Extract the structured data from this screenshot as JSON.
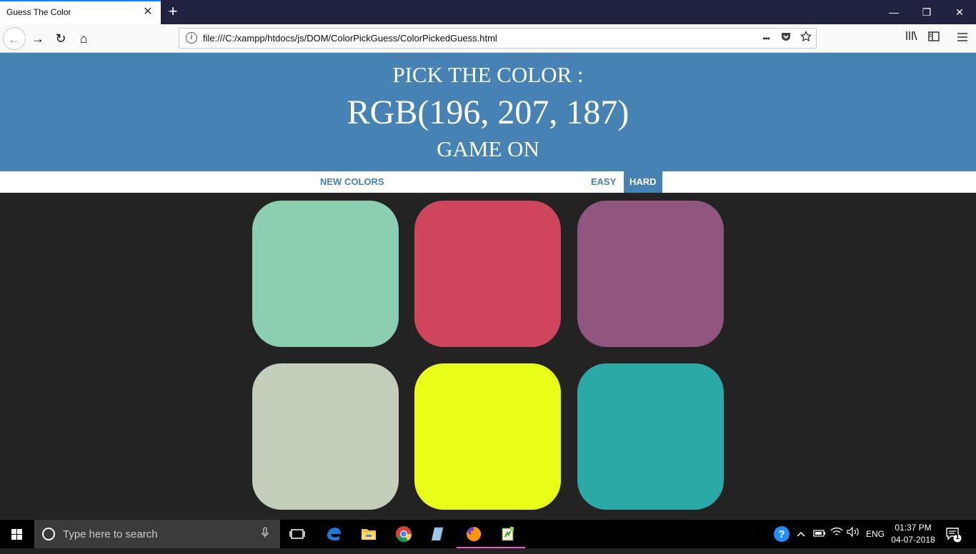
{
  "browser": {
    "tab_title": "Guess The Color",
    "tab_close": "✕",
    "new_tab": "+",
    "window_controls": {
      "minimize": "—",
      "restore": "❐",
      "close": "✕"
    },
    "url": "file:///C:/xampp/htdocs/js/DOM/ColorPickGuess/ColorPickedGuess.html",
    "url_info_glyph": "i",
    "page_actions_glyph": "•••",
    "nav": {
      "back": "←",
      "forward": "→",
      "reload": "↻",
      "home": "⌂"
    }
  },
  "game": {
    "title_line": "PICK THE COLOR :",
    "target_rgb": "RGB(196, 207, 187)",
    "status": "GAME ON",
    "new_colors_label": "NEW COLORS",
    "easy_label": "EASY",
    "hard_label": "HARD",
    "selected_mode": "hard",
    "header_color": "#4682b4",
    "background_color": "#232323",
    "squares": [
      {
        "color": "#8bcfb0"
      },
      {
        "color": "#cf465c"
      },
      {
        "color": "#91567f"
      },
      {
        "color": "#c4cfbb"
      },
      {
        "color": "#e9fe17"
      },
      {
        "color": "#2aa9a6"
      }
    ]
  },
  "taskbar": {
    "search_placeholder": "Type here to search",
    "language": "ENG",
    "time": "01:37 PM",
    "date": "04-07-2018",
    "notification_count": "1",
    "pinned_apps": [
      "task-view-icon",
      "edge-icon",
      "file-explorer-icon",
      "chrome-icon",
      "app-icon",
      "firefox-icon",
      "notepad-plus-icon"
    ]
  }
}
